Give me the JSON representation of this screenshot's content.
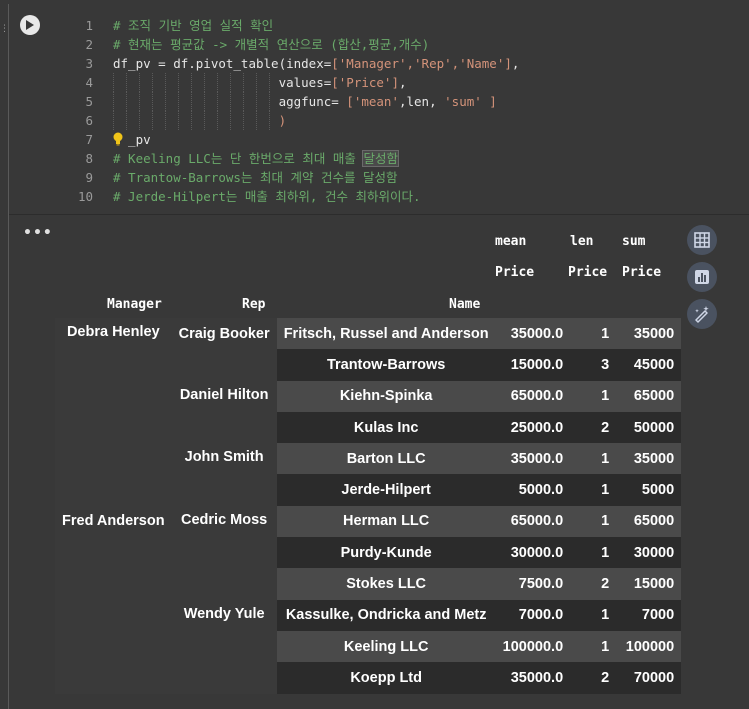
{
  "code": {
    "lines": [
      {
        "n": "1",
        "parts": [
          {
            "t": "# 조직 기반 영업 실적 확인",
            "c": "cm"
          }
        ]
      },
      {
        "n": "2",
        "parts": [
          {
            "t": "# 현재는 평균값 -> 개별적 연산으로 (합산,평균,개수)",
            "c": "cm"
          }
        ]
      },
      {
        "n": "3",
        "parts": [
          {
            "t": "df_pv = df.pivot_table(index=",
            "c": ""
          },
          {
            "t": "['Manager','Rep','Name']",
            "c": "str"
          },
          {
            "t": ",",
            "c": ""
          }
        ]
      },
      {
        "n": "4",
        "parts": [
          {
            "t": "                      values=",
            "c": ""
          },
          {
            "t": "['Price']",
            "c": "str"
          },
          {
            "t": ",",
            "c": ""
          }
        ]
      },
      {
        "n": "5",
        "parts": [
          {
            "t": "                      aggfunc= ",
            "c": ""
          },
          {
            "t": "['mean'",
            "c": "str"
          },
          {
            "t": ",len, ",
            "c": ""
          },
          {
            "t": "'sum'",
            "c": "str"
          },
          {
            "t": " ]",
            "c": "str"
          }
        ]
      },
      {
        "n": "6",
        "parts": [
          {
            "t": "                      )",
            "c": "str"
          }
        ]
      },
      {
        "n": "7",
        "parts": [
          {
            "t": "  _pv",
            "c": ""
          }
        ]
      },
      {
        "n": "8",
        "parts": [
          {
            "t": "# Keeling LLC는 단 한번으로 최대 매출 ",
            "c": "cm"
          },
          {
            "t": "달성함",
            "c": "cm hl"
          }
        ]
      },
      {
        "n": "9",
        "parts": [
          {
            "t": "# Trantow-Barrows는 최대 계약 건수를 달성함",
            "c": "cm"
          }
        ]
      },
      {
        "n": "10",
        "parts": [
          {
            "t": "# Jerde-Hilpert는 매출 최하위, 건수 최하위이다.",
            "c": "cm"
          }
        ]
      }
    ]
  },
  "output": {
    "more_label": "•••",
    "headers": {
      "agg": [
        "mean",
        "len",
        "sum"
      ],
      "values": [
        "Price",
        "Price",
        "Price"
      ],
      "index": [
        "Manager",
        "Rep",
        "Name"
      ]
    },
    "managers": [
      "Debra Henley",
      "Fred Anderson"
    ],
    "reps": [
      "Craig Booker",
      "Daniel Hilton",
      "John Smith",
      "Cedric Moss",
      "Wendy Yule"
    ],
    "rows": [
      {
        "name": "Fritsch, Russel and Anderson",
        "mean": "35000.0",
        "len": "1",
        "sum": "35000"
      },
      {
        "name": "Trantow-Barrows",
        "mean": "15000.0",
        "len": "3",
        "sum": "45000"
      },
      {
        "name": "Kiehn-Spinka",
        "mean": "65000.0",
        "len": "1",
        "sum": "65000"
      },
      {
        "name": "Kulas Inc",
        "mean": "25000.0",
        "len": "2",
        "sum": "50000"
      },
      {
        "name": "Barton LLC",
        "mean": "35000.0",
        "len": "1",
        "sum": "35000"
      },
      {
        "name": "Jerde-Hilpert",
        "mean": "5000.0",
        "len": "1",
        "sum": "5000"
      },
      {
        "name": "Herman LLC",
        "mean": "65000.0",
        "len": "1",
        "sum": "65000"
      },
      {
        "name": "Purdy-Kunde",
        "mean": "30000.0",
        "len": "1",
        "sum": "30000"
      },
      {
        "name": "Stokes LLC",
        "mean": "7500.0",
        "len": "2",
        "sum": "15000"
      },
      {
        "name": "Kassulke, Ondricka and Metz",
        "mean": "7000.0",
        "len": "1",
        "sum": "7000"
      },
      {
        "name": "Keeling LLC",
        "mean": "100000.0",
        "len": "1",
        "sum": "100000"
      },
      {
        "name": "Koepp Ltd",
        "mean": "35000.0",
        "len": "2",
        "sum": "70000"
      }
    ]
  }
}
